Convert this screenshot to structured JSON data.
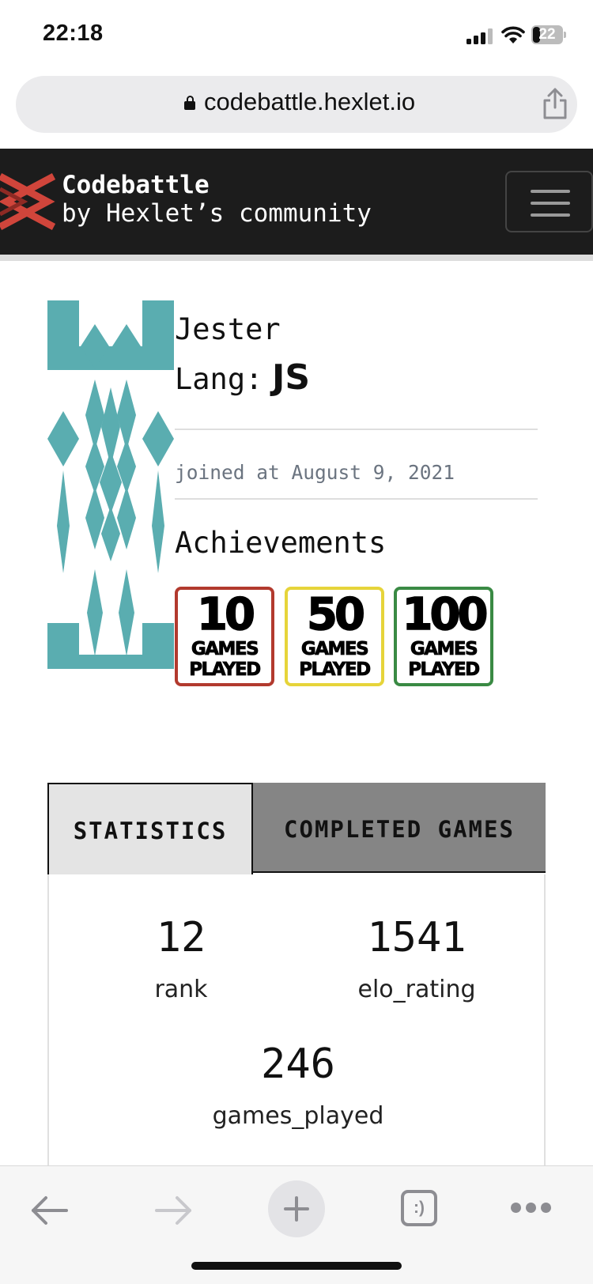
{
  "status_bar": {
    "time": "22:18",
    "battery_level": "22"
  },
  "browser": {
    "url": "codebattle.hexlet.io"
  },
  "navbar": {
    "brand_title": "Codebattle",
    "brand_subtitle": "by Hexlet’s community"
  },
  "profile": {
    "name": "Jester",
    "lang_label": "Lang:",
    "lang_value": "JS",
    "joined": "joined at August 9, 2021",
    "achievements_title": "Achievements",
    "achievements": [
      {
        "number": "10",
        "line1": "GAMES",
        "line2": "PLAYED",
        "border_color": "#b23a2e"
      },
      {
        "number": "50",
        "line1": "GAMES",
        "line2": "PLAYED",
        "border_color": "#e6d43a"
      },
      {
        "number": "100",
        "line1": "GAMES",
        "line2": "PLAYED",
        "border_color": "#3a8a44"
      }
    ]
  },
  "tabs": [
    {
      "label": "STATISTICS",
      "active": true
    },
    {
      "label": "COMPLETED GAMES",
      "active": false
    }
  ],
  "stats": {
    "rank": {
      "value": "12",
      "label": "rank"
    },
    "elo_rating": {
      "value": "1541",
      "label": "elo_rating"
    },
    "games_played": {
      "value": "246",
      "label": "games_played"
    }
  },
  "toolbar": {
    "tabs_glyph": ":)"
  },
  "colors": {
    "navbar_bg": "#1c1c1c",
    "avatar_teal": "#5aadb0",
    "logo_red": "#d0453b"
  }
}
